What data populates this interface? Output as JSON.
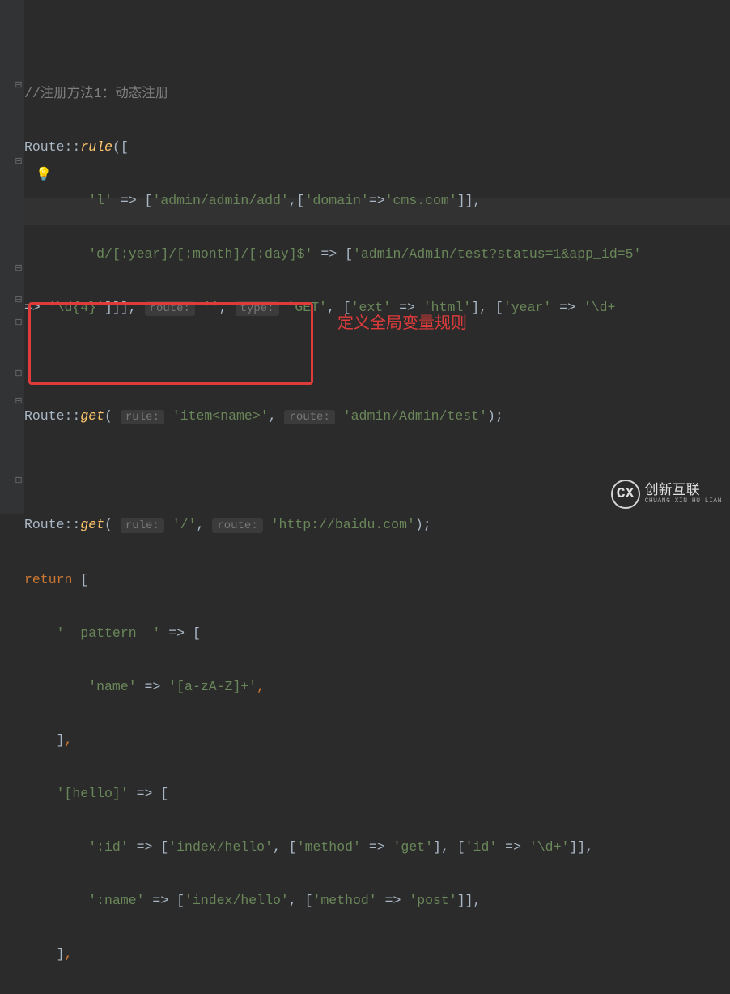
{
  "lines": {
    "comment": "//注册方法1：动态注册",
    "l2": {
      "cls": "Route",
      "sep": "::",
      "fn": "rule",
      "open": "(["
    },
    "l3": {
      "pre": "        ",
      "k": "'l'",
      "arrow": " => [",
      "v1": "'admin/admin/add'",
      "c": ",[",
      "v2": "'domain'",
      "arrow2": "=>",
      "v3": "'cms.com'",
      "close": "]],"
    },
    "l4": {
      "pre": "        ",
      "k": "'d/[:year]/[:month]/[:day]$'",
      "arrow": " => [",
      "v1": "'admin/Admin/test?status=1&app_id=5'"
    },
    "l5": {
      "arrow": "=> ",
      "v1": "'\\d{4}'",
      "close": "]]], ",
      "hint1": "route:",
      "sp1": " ",
      "v2": "''",
      "c1": ", ",
      "hint2": "type:",
      "sp2": " ",
      "v3": "'GET'",
      "c2": ", [",
      "v4": "'ext'",
      "arrow2": " => ",
      "v5": "'html'",
      "c3": "], [",
      "v6": "'year'",
      "arrow3": " => ",
      "v7": "'\\d+"
    },
    "l7": {
      "cls": "Route",
      "sep": "::",
      "fn": "get",
      "open": "( ",
      "hint1": "rule:",
      "sp1": " ",
      "v1": "'item<name>'",
      "c1": ", ",
      "hint2": "route:",
      "sp2": " ",
      "v2": "'admin/Admin/test'",
      "close": ");"
    },
    "l9": {
      "cls": "Route",
      "sep": "::",
      "fn": "get",
      "open": "( ",
      "hint1": "rule:",
      "sp1": " ",
      "v1": "'/'",
      "c1": ", ",
      "hint2": "route:",
      "sp2": " ",
      "v2": "'http://baidu.com'",
      "close": ");"
    },
    "l10": {
      "ret": "return",
      "sp": " ",
      "open": "["
    },
    "l11": {
      "pre": "    ",
      "k": "'__pattern__'",
      "arrow": " => ["
    },
    "l12": {
      "pre": "        ",
      "k": "'name'",
      "arrow": " => ",
      "v": "'[a-zA-Z]+'",
      "c": ","
    },
    "l13": {
      "pre": "    ",
      "close": "]",
      "c": ","
    },
    "l14": {
      "pre": "    ",
      "k": "'[hello]'",
      "arrow": " => ["
    },
    "l15": {
      "pre": "        ",
      "k": "':id'",
      "arrow": " => [",
      "v1": "'index/hello'",
      "c1": ", [",
      "v2": "'method'",
      "arrow2": " => ",
      "v3": "'get'",
      "c2": "], [",
      "v4": "'id'",
      "arrow3": " => ",
      "v5": "'\\d+'",
      "close": "]],"
    },
    "l16": {
      "pre": "        ",
      "k": "':name'",
      "arrow": " => [",
      "v1": "'index/hello'",
      "c1": ", [",
      "v2": "'method'",
      "arrow2": " => ",
      "v3": "'post'",
      "close": "]],"
    },
    "l17": {
      "pre": "    ",
      "close": "]",
      "c": ","
    }
  },
  "annotation": "定义全局变量规则",
  "bulb": "💡",
  "watermark": {
    "cn": "创新互联",
    "en": "CHUANG XIN HU LIAN",
    "logo": "CX"
  }
}
